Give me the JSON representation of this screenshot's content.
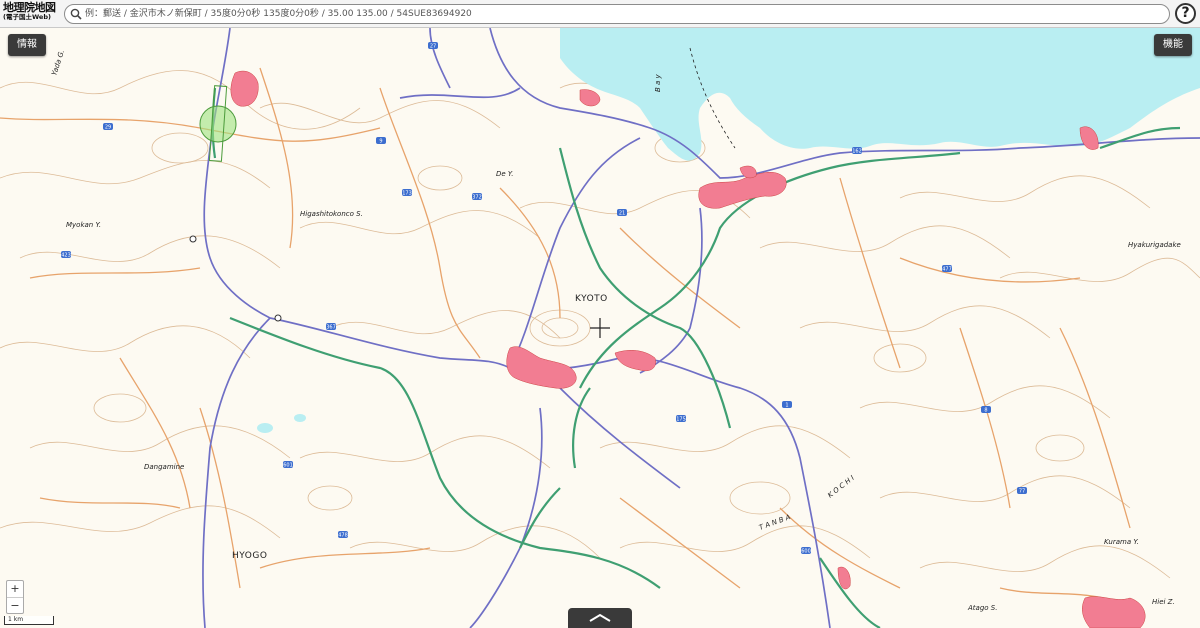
{
  "header": {
    "logo_main": "地理院地図",
    "logo_sub": "(電子国土Web)",
    "search_placeholder": "例：郵送 / 金沢市木ノ新保町 / 35度0分0秒 135度0分0秒 / 35.00 135.00 / 54SUE83694920",
    "help_label": "?"
  },
  "buttons": {
    "info": "情報",
    "functions": "機能"
  },
  "zoom": {
    "in": "+",
    "out": "−"
  },
  "scale": {
    "label": "1 km"
  },
  "icons": {
    "search": "search-icon",
    "help": "help-icon",
    "crosshair": "crosshair-icon",
    "panel_toggle": "chevron-up-icon"
  },
  "map": {
    "labels": {
      "kyoto": "KYOTO",
      "hyogo": "HYOGO",
      "higashitokonco": "Higashitokonco S.",
      "myokan": "Myokan Y.",
      "dangamine": "Dangamine",
      "hyakurigadake": "Hyakurigadake",
      "kurama": "Kurama Y.",
      "atago": "Atago S.",
      "hiei": "Hiei Z.",
      "dey": "De Y.",
      "yada": "Yada G.",
      "tanba": "T A N B A",
      "kochi": "K O C H I",
      "bay": "B a y"
    },
    "route_numbers": [
      "27",
      "9",
      "173",
      "372",
      "21",
      "162",
      "477",
      "367",
      "423",
      "29",
      "175",
      "1",
      "8",
      "77",
      "600",
      "601",
      "478"
    ],
    "colors": {
      "water": "#b9eef2",
      "urban": "#f27d92",
      "national_road": "#6f6fc5",
      "prefectural_road": "#e7a36b",
      "expressway": "#3f9f72",
      "contour": "#c99b6b",
      "background": "#fdfaf2"
    }
  }
}
